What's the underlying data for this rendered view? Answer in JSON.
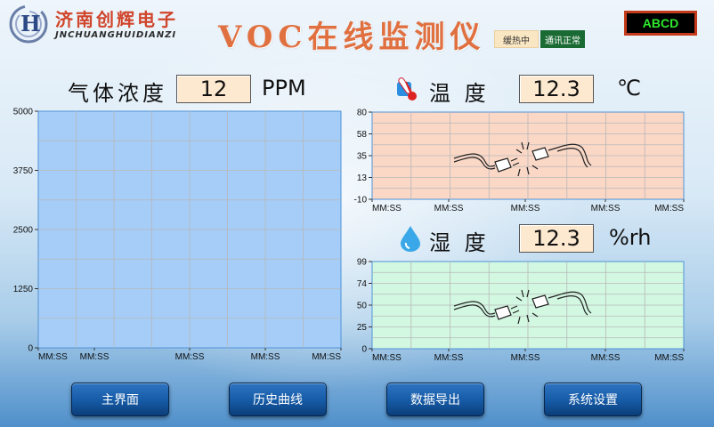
{
  "header": {
    "company_name": "济南创辉电子",
    "company_en": "JNCHUANGHUIDIANZI",
    "logo_letter": "H",
    "title": "VOC在线监测仪",
    "status_left": "缓热中",
    "status_right": "通讯正常",
    "device_id": "ABCD"
  },
  "gas": {
    "label": "气体浓度",
    "value": "12",
    "unit": "PPM"
  },
  "temperature": {
    "label": "温 度",
    "value": "12.3",
    "unit": "℃"
  },
  "humidity": {
    "label": "湿 度",
    "value": "12.3",
    "unit": "%rh"
  },
  "buttons": {
    "main": "主界面",
    "history": "历史曲线",
    "export": "数据导出",
    "settings": "系统设置"
  },
  "colors": {
    "gas_bg": "#a6cdf7",
    "temp_bg": "#fbd7c6",
    "hum_bg": "#d2f8e1",
    "grid": "#b8b8b8",
    "title": "#e07040"
  },
  "chart_data": [
    {
      "type": "line",
      "id": "gas",
      "title": "",
      "yticks": [
        "5000",
        "3750",
        "2500",
        "1250",
        "0"
      ],
      "ylim": [
        0,
        5000
      ],
      "xticks": [
        "MM:SS",
        "MM:SS",
        "MM:SS",
        "MM:SS",
        "MM:SS"
      ],
      "grid": true,
      "series": []
    },
    {
      "type": "line",
      "id": "temperature",
      "title": "",
      "yticks": [
        "80",
        "58",
        "35",
        "13",
        "-10"
      ],
      "ylim": [
        -10,
        80
      ],
      "xticks": [
        "MM:SS",
        "MM:SS",
        "MM:SS",
        "MM:SS",
        "MM:SS"
      ],
      "grid": true,
      "series": []
    },
    {
      "type": "line",
      "id": "humidity",
      "title": "",
      "yticks": [
        "99",
        "74",
        "50",
        "25",
        "0"
      ],
      "ylim": [
        0,
        99
      ],
      "xticks": [
        "MM:SS",
        "MM:SS",
        "MM:SS",
        "MM:SS",
        "MM:SS"
      ],
      "grid": true,
      "series": []
    }
  ]
}
